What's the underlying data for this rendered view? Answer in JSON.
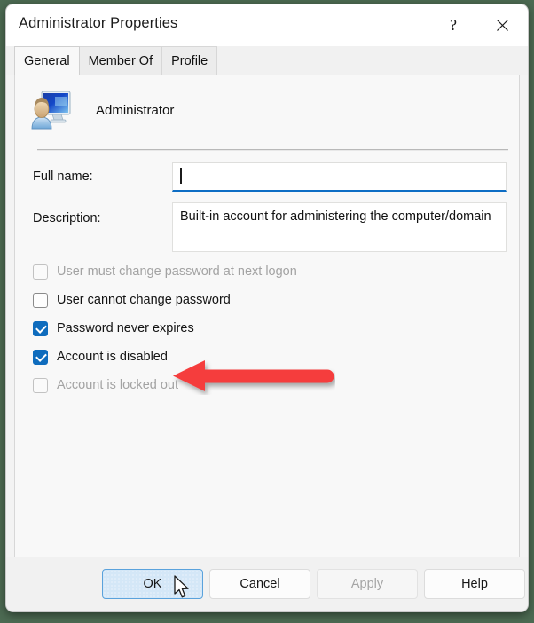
{
  "window": {
    "title": "Administrator Properties",
    "help_icon": "question-mark-icon",
    "close_icon": "close-x-icon"
  },
  "tabs": [
    {
      "label": "General",
      "active": true
    },
    {
      "label": "Member Of",
      "active": false
    },
    {
      "label": "Profile",
      "active": false
    }
  ],
  "identity": {
    "icon": "user-account-icon",
    "name": "Administrator"
  },
  "form": {
    "fullname": {
      "label": "Full name:",
      "value": "",
      "placeholder": "",
      "focused": true
    },
    "description": {
      "label": "Description:",
      "value": "Built-in account for administering the computer/domain",
      "placeholder": ""
    }
  },
  "options": [
    {
      "label": "User must change password at next logon",
      "checked": false,
      "disabled": true
    },
    {
      "label": "User cannot change password",
      "checked": false,
      "disabled": false
    },
    {
      "label": "Password never expires",
      "checked": true,
      "disabled": false
    },
    {
      "label": "Account is disabled",
      "checked": true,
      "disabled": false
    },
    {
      "label": "Account is locked out",
      "checked": false,
      "disabled": true
    }
  ],
  "annotation": {
    "icon": "red-left-arrow-annotation",
    "points_at": "Account is disabled",
    "color": "#f53c3c"
  },
  "buttons": {
    "ok": "OK",
    "cancel": "Cancel",
    "apply": "Apply",
    "help": "Help"
  },
  "cursor": {
    "icon": "mouse-pointer-icon",
    "over": "OK"
  },
  "colors": {
    "accent": "#0f6cbd",
    "focus_underline": "#0d6dc4",
    "annotation_red": "#f53c3c",
    "desktop": "#4c6a52"
  }
}
